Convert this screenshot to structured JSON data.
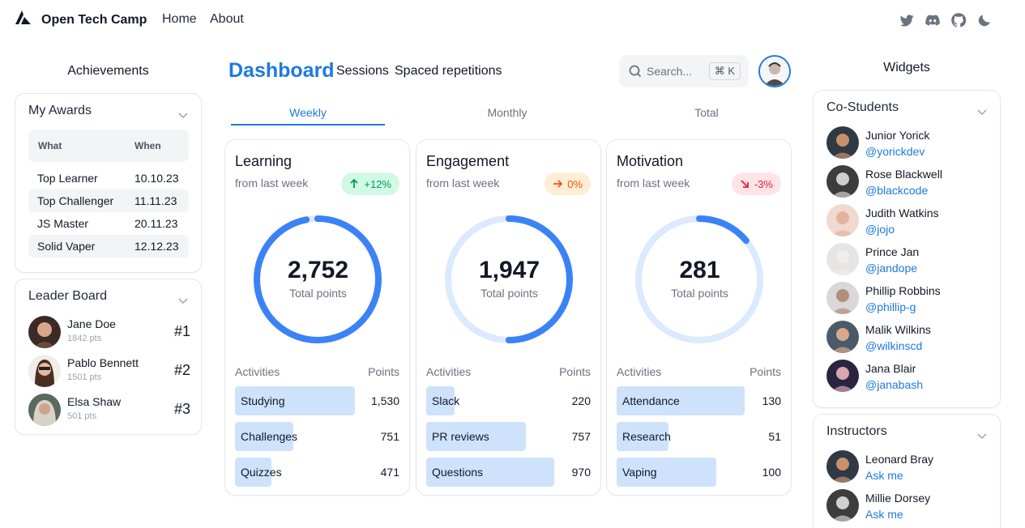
{
  "nav": {
    "brand": "Open Tech Camp",
    "links": [
      "Home",
      "About"
    ],
    "social_icons": [
      "twitter-icon",
      "discord-icon",
      "github-icon",
      "moon-icon"
    ]
  },
  "achievements": {
    "heading": "Achievements",
    "awards": {
      "title": "My Awards",
      "col_what": "What",
      "col_when": "When",
      "rows": [
        {
          "what": "Top Learner",
          "when": "10.10.23"
        },
        {
          "what": "Top Challenger",
          "when": "11.11.23"
        },
        {
          "what": "JS Master",
          "when": "20.11.23"
        },
        {
          "what": "Solid Vaper",
          "when": "12.12.23"
        }
      ]
    },
    "leaderboard": {
      "title": "Leader Board",
      "entries": [
        {
          "name": "Jane Doe",
          "points": "1842 pts",
          "rank": "#1"
        },
        {
          "name": "Pablo Bennett",
          "points": "1501 pts",
          "rank": "#2"
        },
        {
          "name": "Elsa Shaw",
          "points": "501 pts",
          "rank": "#3"
        }
      ]
    }
  },
  "dashboard": {
    "title": "Dashboard",
    "links": [
      "Sessions",
      "Spaced repetitions"
    ],
    "search": {
      "placeholder": "Search...",
      "shortcut": "⌘ K"
    },
    "tabs": [
      "Weekly",
      "Monthly",
      "Total"
    ],
    "active_tab": "Weekly",
    "ring_caption": "Total points",
    "col_activities": "Activities",
    "col_points": "Points",
    "cards": [
      {
        "title": "Learning",
        "subtitle": "from last week",
        "change": "+12%",
        "trend": "up",
        "total": "2,752",
        "progress": 0.97,
        "activities": [
          {
            "name": "Studying",
            "points": "1,530",
            "share": 0.72
          },
          {
            "name": "Challenges",
            "points": "751",
            "share": 0.35
          },
          {
            "name": "Quizzes",
            "points": "471",
            "share": 0.22
          }
        ]
      },
      {
        "title": "Engagement",
        "subtitle": "from last week",
        "change": "0%",
        "trend": "flat",
        "total": "1,947",
        "progress": 0.5,
        "activities": [
          {
            "name": "Slack",
            "points": "220",
            "share": 0.17
          },
          {
            "name": "PR reviews",
            "points": "757",
            "share": 0.6
          },
          {
            "name": "Questions",
            "points": "970",
            "share": 0.77
          }
        ]
      },
      {
        "title": "Motivation",
        "subtitle": "from last week",
        "change": "-3%",
        "trend": "down",
        "total": "281",
        "progress": 0.14,
        "activities": [
          {
            "name": "Attendance",
            "points": "130",
            "share": 0.77
          },
          {
            "name": "Research",
            "points": "51",
            "share": 0.31
          },
          {
            "name": "Vaping",
            "points": "100",
            "share": 0.6
          }
        ]
      }
    ]
  },
  "widgets": {
    "heading": "Widgets",
    "costudents": {
      "title": "Co-Students",
      "people": [
        {
          "name": "Junior Yorick",
          "handle": "@yorickdev"
        },
        {
          "name": "Rose Blackwell",
          "handle": "@blackcode"
        },
        {
          "name": "Judith Watkins",
          "handle": "@jojo"
        },
        {
          "name": "Prince Jan",
          "handle": "@jandope"
        },
        {
          "name": "Phillip Robbins",
          "handle": "@phillip-g"
        },
        {
          "name": "Malik Wilkins",
          "handle": "@wilkinscd"
        },
        {
          "name": "Jana Blair",
          "handle": "@janabash"
        }
      ]
    },
    "instructors": {
      "title": "Instructors",
      "people": [
        {
          "name": "Leonard Bray",
          "action": "Ask me"
        },
        {
          "name": "Millie Dorsey",
          "action": "Ask me"
        }
      ]
    }
  },
  "colors": {
    "accent": "#1d7ae0",
    "ring": "#3b82f6",
    "ring_track": "#dbeafe",
    "bar": "#cfe2fc"
  }
}
